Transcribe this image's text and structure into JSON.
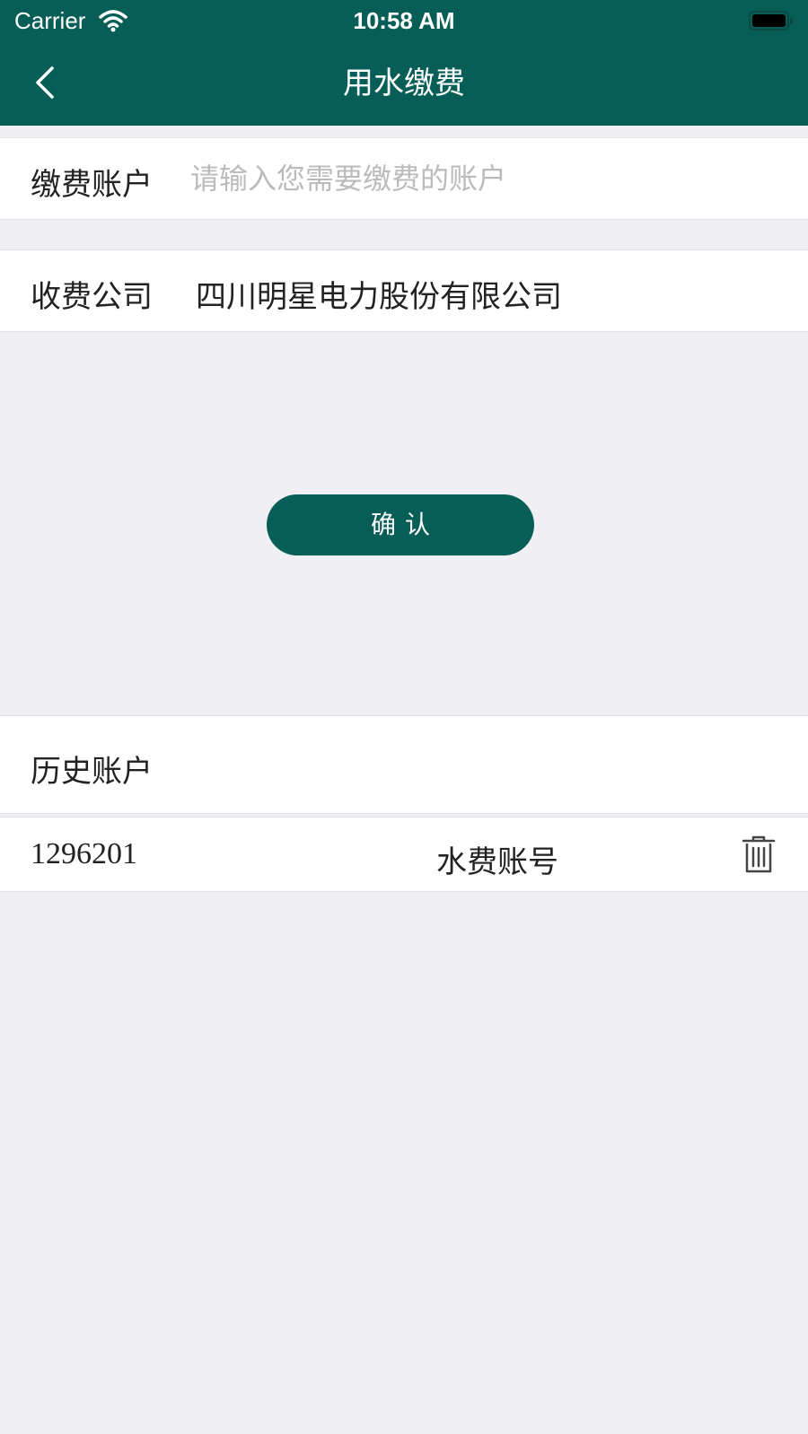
{
  "status_bar": {
    "carrier": "Carrier",
    "time": "10:58 AM"
  },
  "nav": {
    "title": "用水缴费",
    "back_icon": "chevron-left-icon"
  },
  "form": {
    "account_label": "缴费账户",
    "account_value": "",
    "account_placeholder": "请输入您需要缴费的账户",
    "company_label": "收费公司",
    "company_value": "四川明星电力股份有限公司"
  },
  "confirm_label": "确认",
  "history": {
    "title": "历史账户",
    "items": [
      {
        "account": "1296201",
        "type": "水费账号",
        "delete_icon": "trash-icon"
      }
    ]
  },
  "colors": {
    "primary": "#065e56",
    "background": "#efeff4",
    "placeholder": "#bbbbbb"
  }
}
